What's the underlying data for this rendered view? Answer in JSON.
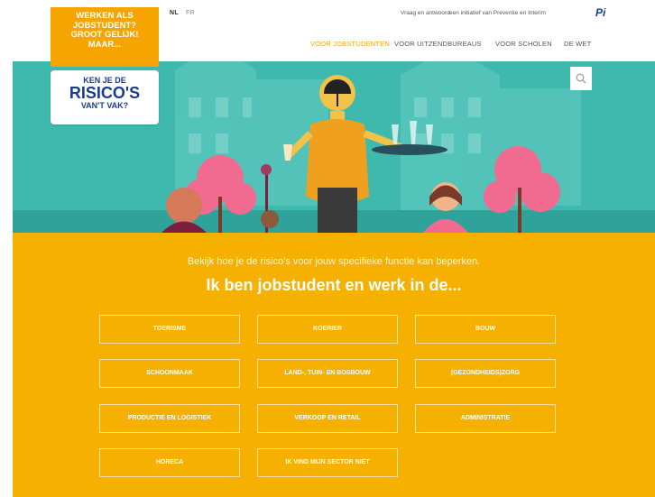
{
  "topbar": {
    "lang_nl": "NL",
    "lang_fr": "FR",
    "faq": "Vraag en antwoord",
    "initiative": "een initiatief van Preventie en Interim",
    "pi_logo": "Pi"
  },
  "nav": {
    "items": [
      {
        "label": "VOOR JOBSTUDENTEN",
        "active": true
      },
      {
        "label": "VOOR UITZENDBUREAUS",
        "active": false
      },
      {
        "label": "VOOR SCHOLEN",
        "active": false
      },
      {
        "label": "DE WET",
        "active": false
      }
    ]
  },
  "badge": {
    "line1": "WERKEN ALS",
    "line2": "JOBSTUDENT?",
    "line3": "GROOT GELIJK!",
    "line4": "MAAR..."
  },
  "logo": {
    "line1": "KEN JE DE",
    "line2": "RISICO'S",
    "line3": "VAN'T VAK?"
  },
  "main": {
    "intro": "Bekijk hoe je de risico's voor jouw specifieke functie kan beperken.",
    "heading": "Ik ben jobstudent en werk in de...",
    "sectors": [
      "TOERISME",
      "KOERIER",
      "BOUW",
      "SCHOONMAAK",
      "LAND-, TUIN- EN BOSBOUW",
      "(GEZONDHEIDS)ZORG",
      "PRODUCTIE EN LOGISTIEK",
      "VERKOOP EN RETAIL",
      "ADMINISTRATIE",
      "HORECA",
      "IK VIND MIJN SECTOR NIET"
    ]
  },
  "colors": {
    "orange": "#f5b000",
    "badge_orange": "#f5a400",
    "teal": "#3fb8ad",
    "navy": "#1a3c8f"
  }
}
